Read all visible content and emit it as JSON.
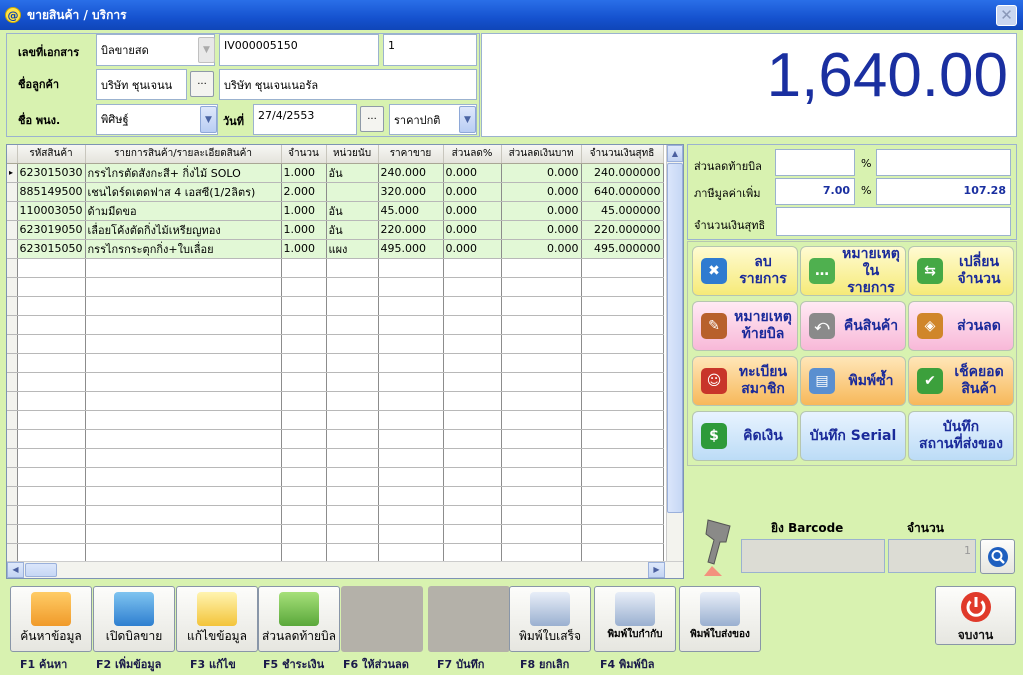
{
  "window": {
    "title": "ขายสินค้า / บริการ",
    "app_icon": "@"
  },
  "header": {
    "doc_label": "เลขที่เอกสาร",
    "doc_type": "บิลขายสด",
    "doc_no": "IV000005150",
    "doc_seq": "1",
    "customer_label": "ชื่อลูกค้า",
    "customer_code": "บริษัท ชุนเจนน",
    "customer_name": "บริษัท ชุนเจนเนอรัล",
    "employee_label": "ชื่อ พนง.",
    "employee": "พิศิษฐ์",
    "date_label": "วันที่",
    "date": "27/4/2553",
    "price_type": "ราคาปกติ",
    "ellipsis": "..."
  },
  "total_amount": "1,640.00",
  "grid": {
    "columns": [
      "รหัสสินค้า",
      "รายการสินค้า/รายละเอียดสินค้า",
      "จำนวน",
      "หน่วยนับ",
      "ราคาขาย",
      "ส่วนลด%",
      "ส่วนลดเงินบาท",
      "จำนวนเงินสุทธิ"
    ],
    "rows": [
      [
        "623015030",
        "กรรไกรตัดสังกะสี+ กิ่งไม้ SOLO",
        "1.000",
        "อัน",
        "240.000",
        "0.000",
        "0.000",
        "240.000000"
      ],
      [
        "885149500",
        "เชนไดร์ดเตดฟาส 4 เอสซี(1/2ลิตร)",
        "2.000",
        "",
        "320.000",
        "0.000",
        "0.000",
        "640.000000"
      ],
      [
        "110003050",
        "ด้ามมีดขอ",
        "1.000",
        "อัน",
        "45.000",
        "0.000",
        "0.000",
        "45.000000"
      ],
      [
        "623019050",
        "เลื่อยโค้งตัดกิ่งไม้เหรียญทอง",
        "1.000",
        "อัน",
        "220.000",
        "0.000",
        "0.000",
        "220.000000"
      ],
      [
        "623015050",
        "กรรไกรกระตุกกิ่ง+ใบเลื่อย",
        "1.000",
        "แผง",
        "495.000",
        "0.000",
        "0.000",
        "495.000000"
      ]
    ]
  },
  "summary": {
    "bill_discount_label": "ส่วนลดท้ายบิล",
    "vat_label": "ภาษีมูลค่าเพิ่ม",
    "vat_rate": "7.00",
    "vat_amount": "107.28",
    "net_label": "จำนวนเงินสุทธิ",
    "percent": "%"
  },
  "actions": [
    {
      "label": "ลบรายการ",
      "icon": "delete-item-icon",
      "color": "#f6ea78"
    },
    {
      "label": "หมายเหตุ ในรายการ",
      "icon": "chat-note-icon",
      "color": "#f6ea78"
    },
    {
      "label": "เปลี่ยน จำนวน",
      "icon": "swap-arrows-icon",
      "color": "#f6ea78"
    },
    {
      "label": "หมายเหตุ ท้ายบิล",
      "icon": "notebook-icon",
      "color": "#f8b8d8"
    },
    {
      "label": "คืนสินค้า",
      "icon": "return-box-icon",
      "color": "#f8b8d8"
    },
    {
      "label": "ส่วนลด",
      "icon": "price-tag-icon",
      "color": "#f8b8d8"
    },
    {
      "label": "ทะเบียน สมาชิก",
      "icon": "member-icon",
      "color": "#f7b85a"
    },
    {
      "label": "พิมพ์ซ้ำ",
      "icon": "printer-icon",
      "color": "#f7b85a"
    },
    {
      "label": "เช็คยอด สินค้า",
      "icon": "check-stock-icon",
      "color": "#f7b85a"
    },
    {
      "label": "คิดเงิน",
      "icon": "dollar-icon",
      "color": "#bcdcf6"
    },
    {
      "label": "บันทึก Serial",
      "icon": "",
      "color": "#bcdcf6"
    },
    {
      "label": "บันทึก สถานที่ส่งของ",
      "icon": "",
      "color": "#bcdcf6"
    }
  ],
  "barcode": {
    "label": "ยิง Barcode",
    "qty_label": "จำนวน",
    "qty_value": "1"
  },
  "function_buttons": [
    {
      "label": "ค้นหาข้อมูล",
      "key": "F1  ค้นหา",
      "icon": "search-folder-icon"
    },
    {
      "label": "เปิดบิลขาย",
      "key": "F2 เพิ่มข้อมูล",
      "icon": "open-bill-icon"
    },
    {
      "label": "แก้ไขข้อมูล",
      "key": "F3 แก้ไข",
      "icon": "pencil-icon"
    },
    {
      "label": "ส่วนลดท้ายบิล",
      "key": "F5 ชำระเงิน",
      "icon": "sale-tag-icon"
    },
    {
      "label": "",
      "key": "F6 ให้ส่วนลด",
      "icon": ""
    },
    {
      "label": "",
      "key": "F7 บันทึก",
      "icon": ""
    },
    {
      "label": "พิมพ์ใบเสร็จ",
      "key": "F8 ยกเลิก",
      "icon": "receipt-printer-icon"
    },
    {
      "label": "พิมพ์ใบกำกับ",
      "key": "F4 พิมพ์บิล",
      "icon": "invoice-printer-icon"
    },
    {
      "label": "พิมพ์ใบส่งของ",
      "key": "",
      "icon": "delivery-printer-icon"
    }
  ],
  "exit_label": "จบงาน"
}
